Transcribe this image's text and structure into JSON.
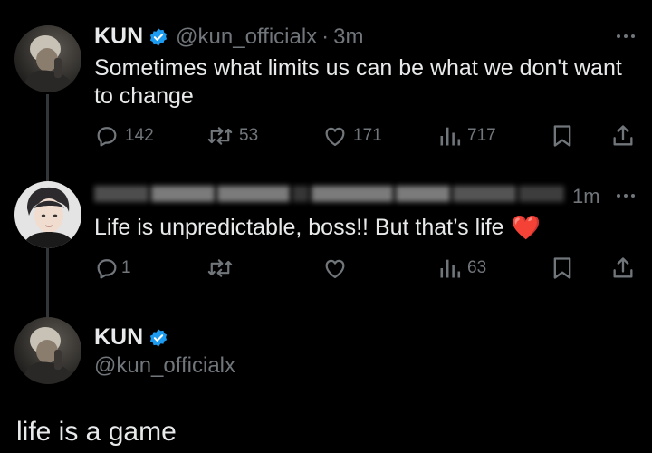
{
  "tweet1": {
    "display_name": "KUN",
    "handle": "@kun_officialx",
    "separator": "·",
    "time": "3m",
    "text_line1": "Sometimes what limits us can be what we don't want",
    "text_line2": "to change",
    "replies": "142",
    "reposts": "53",
    "likes": "171",
    "views": "717"
  },
  "reply": {
    "time": "1m",
    "text": "Life is unpredictable, boss!! But that’s life",
    "emoji": "❤️",
    "replies": "1",
    "views": "63"
  },
  "main_tweet": {
    "display_name": "KUN",
    "handle": "@kun_officialx",
    "text": "life is a game"
  },
  "colors": {
    "background": "#000000",
    "text": "#e7e9ea",
    "muted": "#71767b",
    "verified": "#1d9bf0"
  }
}
